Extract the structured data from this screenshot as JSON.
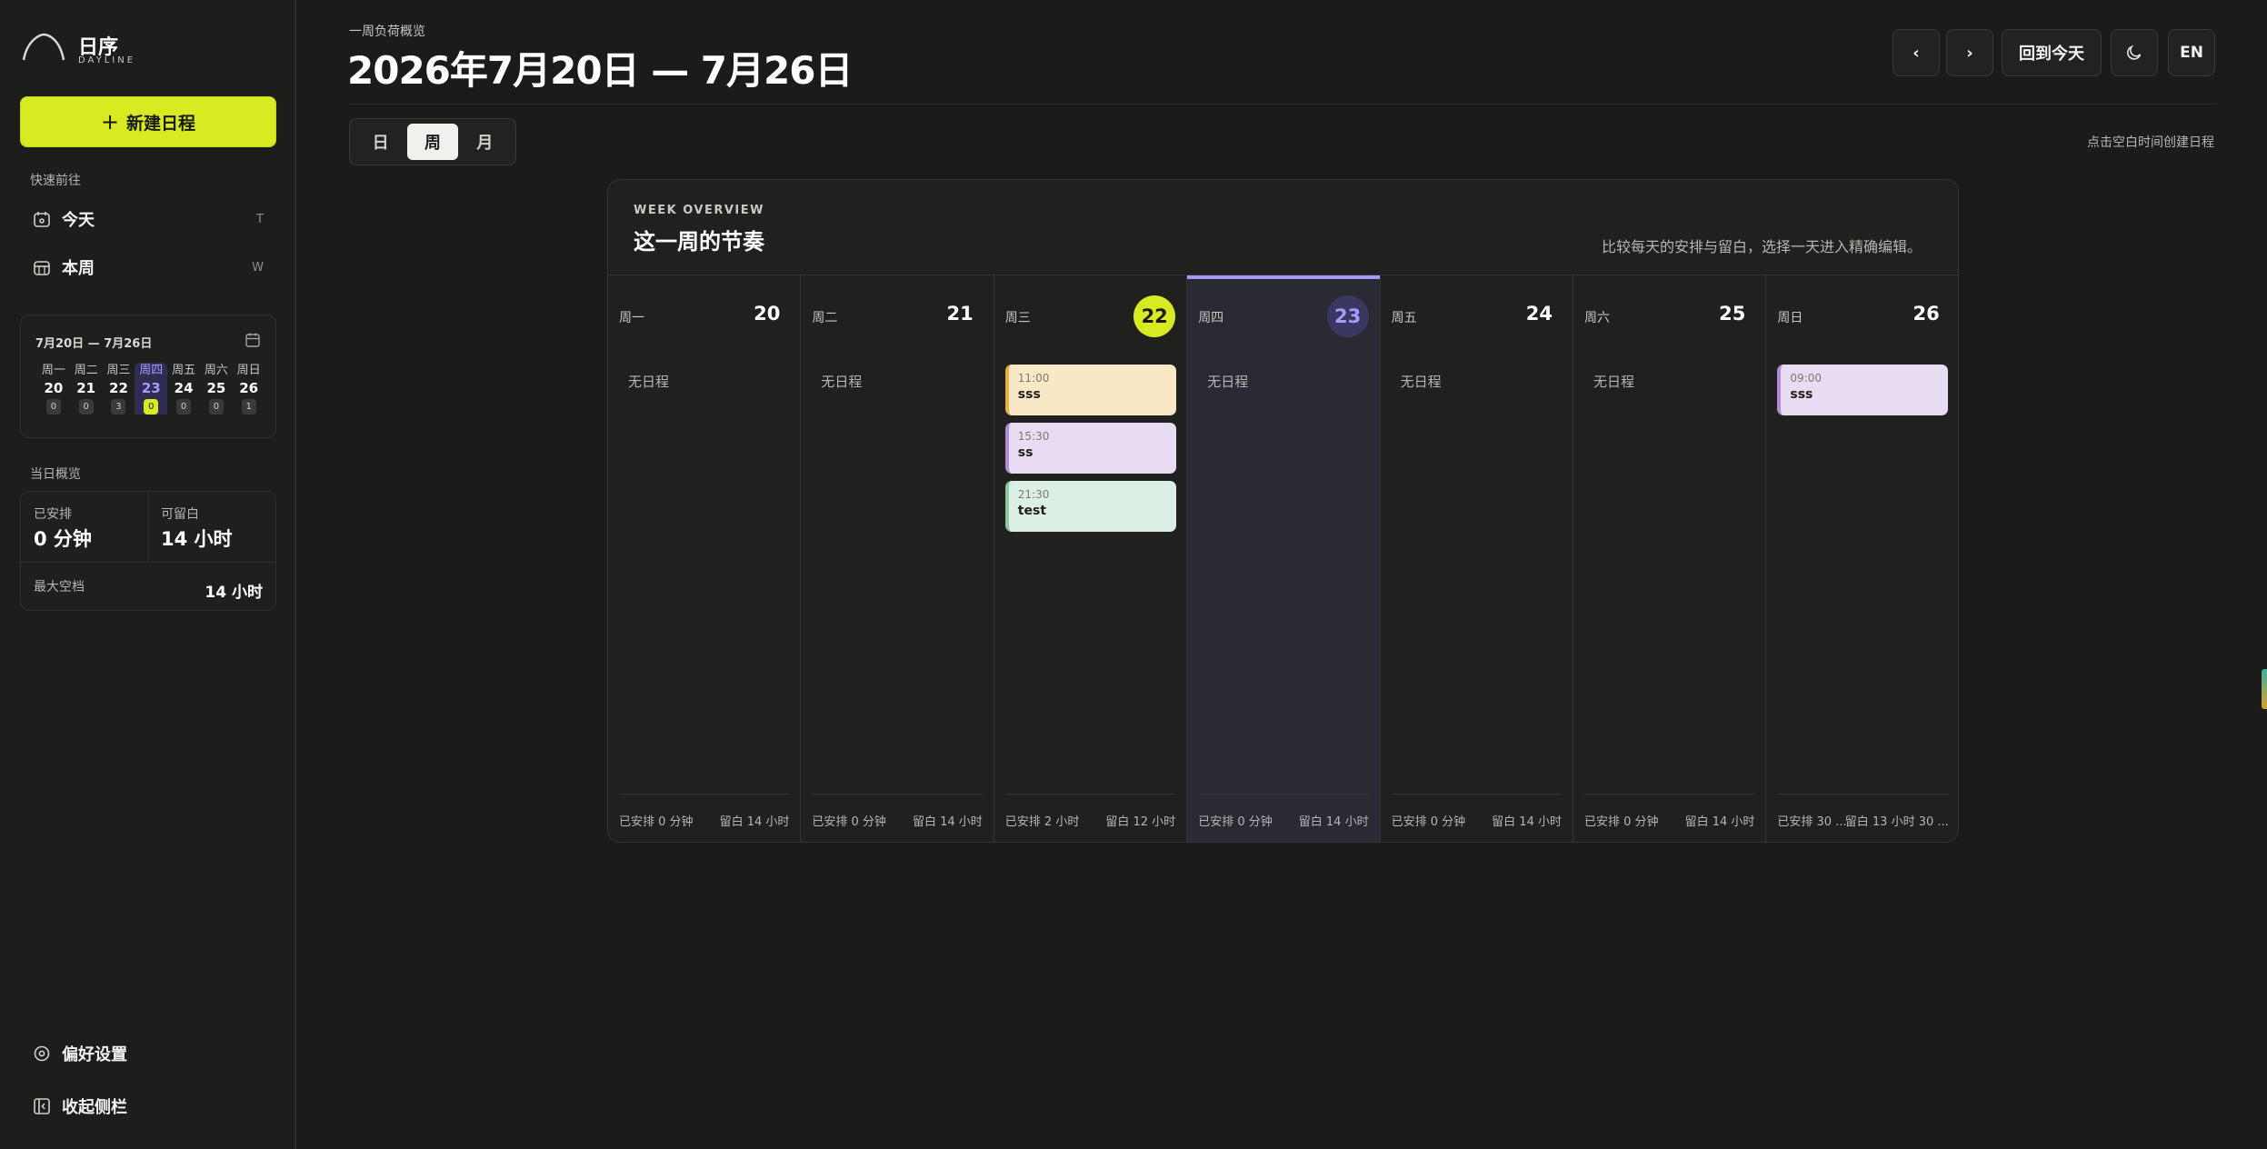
{
  "app": {
    "name": "日序",
    "subtitle": "DAYLINE"
  },
  "sidebar": {
    "new_button": "新建日程",
    "quick_label": "快速前往",
    "quick_items": [
      {
        "label": "今天",
        "shortcut": "T"
      },
      {
        "label": "本周",
        "shortcut": "W"
      }
    ],
    "mini_calendar": {
      "range": "7月20日 — 7月26日",
      "days": [
        {
          "weekday": "周一",
          "day": "20",
          "count": "0"
        },
        {
          "weekday": "周二",
          "day": "21",
          "count": "0"
        },
        {
          "weekday": "周三",
          "day": "22",
          "count": "3"
        },
        {
          "weekday": "周四",
          "day": "23",
          "count": "0"
        },
        {
          "weekday": "周五",
          "day": "24",
          "count": "0"
        },
        {
          "weekday": "周六",
          "day": "25",
          "count": "0"
        },
        {
          "weekday": "周日",
          "day": "26",
          "count": "1"
        }
      ]
    },
    "summary_label": "当日概览",
    "summary": {
      "scheduled_label": "已安排",
      "scheduled_value": "0 分钟",
      "free_label": "可留白",
      "free_value": "14 小时",
      "max_gap_label": "最大空档",
      "max_gap_value": "14 小时"
    },
    "bottom": {
      "preferences": "偏好设置",
      "collapse": "收起侧栏"
    }
  },
  "header": {
    "overline": "一周负荷概览",
    "title": "2026年7月20日 — 7月26日",
    "today_button": "回到今天",
    "lang_button": "EN"
  },
  "view_switch": {
    "day": "日",
    "week": "周",
    "month": "月",
    "active": "week"
  },
  "hint": "点击空白时间创建日程",
  "week_board": {
    "overline": "WEEK OVERVIEW",
    "title": "这一周的节奏",
    "description": "比较每天的安排与留白，选择一天进入精确编辑。",
    "empty_label": "无日程",
    "columns": [
      {
        "weekday": "周一",
        "day": "20",
        "scheduled": "已安排 0 分钟",
        "free": "留白 14 小时",
        "events": []
      },
      {
        "weekday": "周二",
        "day": "21",
        "scheduled": "已安排 0 分钟",
        "free": "留白 14 小时",
        "events": []
      },
      {
        "weekday": "周三",
        "day": "22",
        "scheduled": "已安排 2 小时",
        "free": "留白 12 小时",
        "events": [
          {
            "time": "11:00",
            "title": "sss",
            "bg": "#f8e8c6",
            "border": "#e8b04a"
          },
          {
            "time": "15:30",
            "title": "ss",
            "bg": "#e8dcf2",
            "border": "#b48ad8"
          },
          {
            "time": "21:30",
            "title": "test",
            "bg": "#dcefe4",
            "border": "#8cc9a4"
          }
        ]
      },
      {
        "weekday": "周四",
        "day": "23",
        "scheduled": "已安排 0 分钟",
        "free": "留白 14 小时",
        "events": []
      },
      {
        "weekday": "周五",
        "day": "24",
        "scheduled": "已安排 0 分钟",
        "free": "留白 14 小时",
        "events": []
      },
      {
        "weekday": "周六",
        "day": "25",
        "scheduled": "已安排 0 分钟",
        "free": "留白 14 小时",
        "events": []
      },
      {
        "weekday": "周日",
        "day": "26",
        "scheduled": "已安排 30 ...",
        "free": "留白 13 小时 30 ...",
        "events": [
          {
            "time": "09:00",
            "title": "sss",
            "bg": "#e8dcf2",
            "border": "#b48ad8"
          }
        ]
      }
    ]
  },
  "colors": {
    "accent": "#d7ea22",
    "today": "#a59cff",
    "background": "#1b1c1a"
  }
}
